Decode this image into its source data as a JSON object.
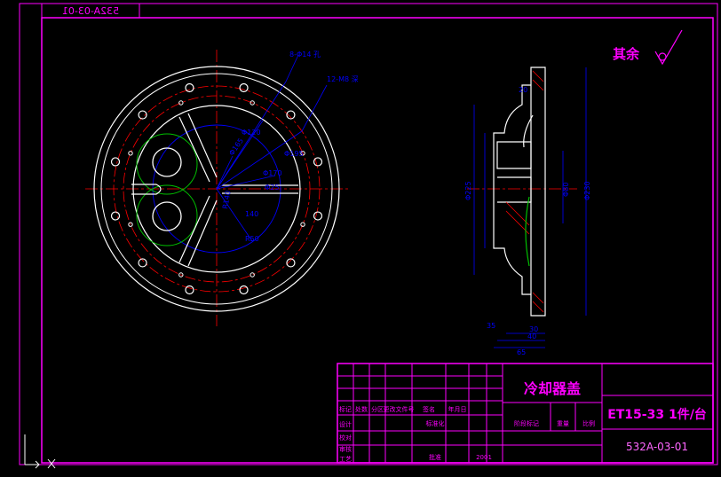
{
  "drawing": {
    "corner_code_mirrored": "532A-03-01",
    "roughness_note": "其余",
    "part_name": "冷却器盖",
    "model_spec": "ET15-33 1件/台",
    "drawing_number": "532A-03-01",
    "weight_label": "重量",
    "scale_label": "比例",
    "stage_mark_label": "阶段标记",
    "std_check_label": "标准化",
    "approve_label": "批准",
    "date_short": "2001",
    "rev_headers": [
      "标记",
      "处数",
      "分区",
      "更改文件号",
      "签名",
      "年月日"
    ],
    "sign_rows": [
      "设计",
      "校对",
      "审核",
      "工艺"
    ]
  },
  "dimensions": {
    "callout_top_1": "8-Φ14 孔",
    "callout_top_2": "12-M8 深",
    "dia_120": "Φ120",
    "dia_165": "Φ165",
    "dia_170": "Φ170",
    "dia_195": "Φ195",
    "dia_25": "Φ25",
    "r140": "R140",
    "d140": "140",
    "r50": "R50",
    "side_20": "20",
    "side_dia225": "Φ225",
    "side_dia230": "Φ230",
    "side_dia80": "Φ80",
    "side_40": "40",
    "side_65": "65",
    "side_30": "30",
    "side_35": "35"
  },
  "colors": {
    "border": "#ff00ff",
    "outline": "#ffffff",
    "center": "#ff0000",
    "dim": "#0000ff",
    "green": "#00c000",
    "magenta": "#ff00ff"
  }
}
